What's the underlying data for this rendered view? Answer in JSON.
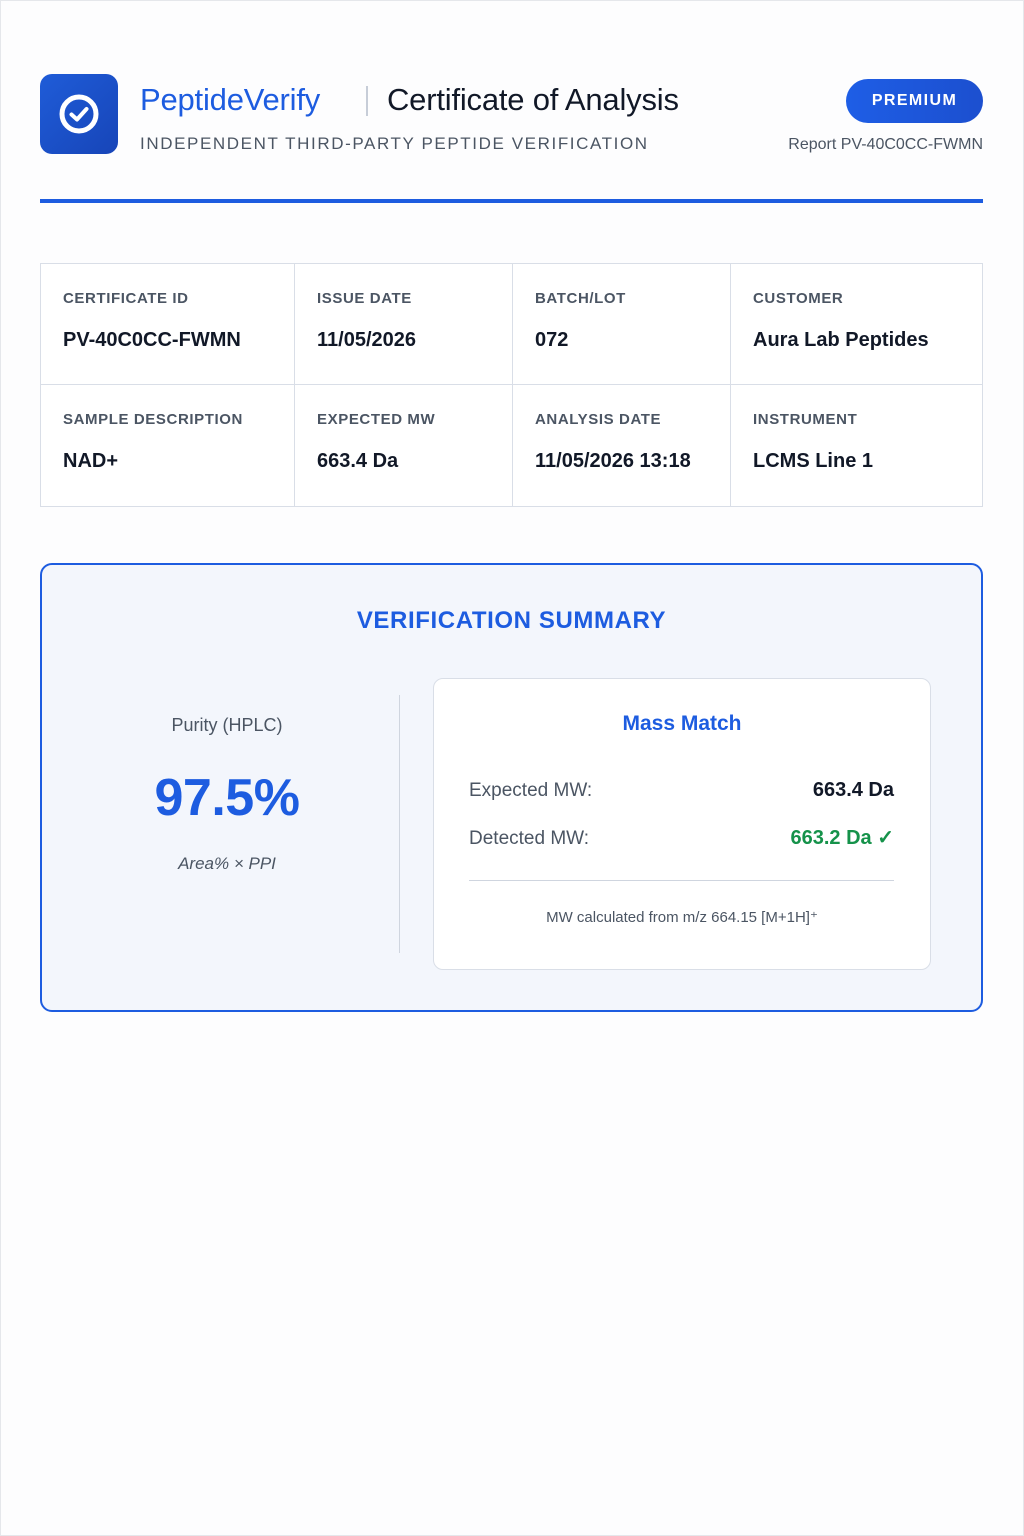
{
  "header": {
    "brand_name": "PeptideVerify",
    "document_title": "Certificate of Analysis",
    "tagline": "INDEPENDENT THIRD-PARTY PEPTIDE VERIFICATION",
    "tier_badge": "PREMIUM",
    "report_id": "Report PV-40C0CC-FWMN",
    "logo_icon": "check-circle-icon"
  },
  "info": {
    "certificate_id": {
      "label": "CERTIFICATE ID",
      "value": "PV-40C0CC-FWMN"
    },
    "issue_date": {
      "label": "ISSUE DATE",
      "value": "11/05/2026"
    },
    "batch_lot": {
      "label": "BATCH/LOT",
      "value": "072"
    },
    "customer": {
      "label": "CUSTOMER",
      "value": "Aura Lab Peptides"
    },
    "sample_description": {
      "label": "SAMPLE DESCRIPTION",
      "value": "NAD+"
    },
    "expected_mw": {
      "label": "EXPECTED MW",
      "value": "663.4 Da"
    },
    "analysis_date": {
      "label": "ANALYSIS DATE",
      "value": "11/05/2026 13:18"
    },
    "instrument": {
      "label": "INSTRUMENT",
      "value": "LCMS Line 1"
    }
  },
  "summary": {
    "title": "VERIFICATION SUMMARY",
    "purity": {
      "label": "Purity (HPLC)",
      "value": "97.5%",
      "note": "Area% × PPI"
    },
    "mass_match": {
      "title": "Mass Match",
      "expected_label": "Expected MW:",
      "expected_value": "663.4 Da",
      "detected_label": "Detected MW:",
      "detected_value": "663.2 Da ✓",
      "footnote": "MW calculated from m/z 664.15 [M+1H]⁺"
    }
  },
  "colors": {
    "brand_blue": "#1d5ce0",
    "success_green": "#15924a",
    "text_dark": "#111827",
    "text_muted": "#4b5563"
  }
}
